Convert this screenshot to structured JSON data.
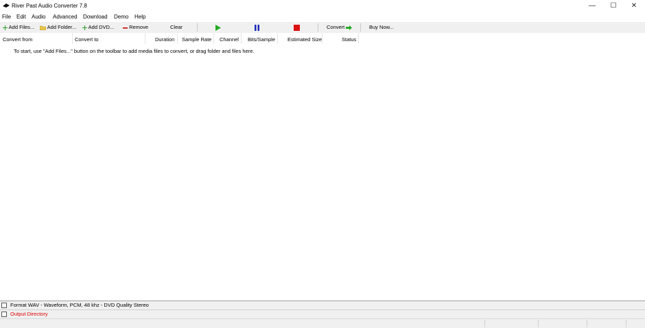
{
  "window": {
    "title": "River Past Audio Converter 7.8",
    "minimize_glyph": "—",
    "maximize_glyph": "☐",
    "close_glyph": "✕"
  },
  "menu": [
    "File",
    "Edit",
    "Audio",
    "Advanced",
    "Download",
    "Demo",
    "Help"
  ],
  "toolbar": {
    "add_files": "Add Files...",
    "add_folder": "Add Folder...",
    "add_dvd": "Add DVD...",
    "remove": "Remove",
    "clear": "Clear",
    "convert": "Convert",
    "buy_now": "Buy Now..."
  },
  "columns": [
    "Convert from",
    "Convert to",
    "Duration",
    "Sample Rate",
    "Channel",
    "Bits/Sample",
    "Estimated Size",
    "Status"
  ],
  "hint": "To start, use \"Add Files...\" button on the toolbar to add media files to convert, or drag folder and files here.",
  "format_line": "Format WAV - Waveform, PCM, 48 khz - DVD Quality Stereo",
  "output_directory": "Output Directory",
  "colors": {
    "play": "#22aa22",
    "pause": "#1a2ab8",
    "stop": "#dd1111",
    "remove": "#cc0000",
    "add": "#2a9a2a",
    "folder": "#e8c54a",
    "output_dir_text": "#dd0000"
  }
}
